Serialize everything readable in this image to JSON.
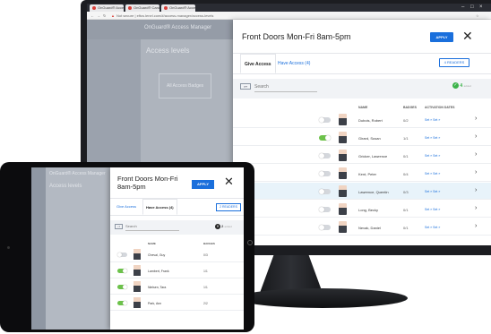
{
  "browser": {
    "tabs": [
      "OnGuard® Access M...",
      "OnGuard® Cardholde...",
      "OnGuard® Access L..."
    ],
    "address": "Not secure | eftcs.lenel.com/#/access-manager/access-levels"
  },
  "background_app": {
    "title": "OnGuard® Access Manager",
    "section": "Access levels",
    "placeholder_card": "All Access Badges"
  },
  "desktop_modal": {
    "title": "Front Doors Mon-Fri 8am-5pm",
    "apply_label": "APPLY",
    "tabs": [
      "Give Access",
      "Have Access (4)"
    ],
    "readers_label": "4 READERS",
    "search_placeholder": "Search",
    "added_count": "4",
    "added_label": "added",
    "columns": [
      "NAME",
      "BADGES",
      "ACTIVATION DATES"
    ],
    "rows": [
      {
        "name": "Dubois, Robert",
        "badges": "0/2",
        "dates": "Set » Set »",
        "toggle": false
      },
      {
        "name": "Girard, Susan",
        "badges": "1/1",
        "dates": "Set » Set »",
        "toggle": true
      },
      {
        "name": "Gricker, Lawrence",
        "badges": "0/1",
        "dates": "Set » Set »",
        "toggle": false
      },
      {
        "name": "Kent, Peter",
        "badges": "0/4",
        "dates": "Set » Set »",
        "toggle": false
      },
      {
        "name": "Lawrence, Quentin",
        "badges": "0/3",
        "dates": "Set » Set »",
        "toggle": false
      },
      {
        "name": "Long, Becky",
        "badges": "0/1",
        "dates": "Set » Set »",
        "toggle": false
      },
      {
        "name": "Nevak, Daniel",
        "badges": "0/1",
        "dates": "Set » Set »",
        "toggle": false
      }
    ]
  },
  "tablet_modal": {
    "title": "Front Doors Mon-Fri 8am-5pm",
    "apply_label": "APPLY",
    "tabs": [
      "Give Access",
      "Have Access (4)"
    ],
    "readers_label": "2 READERS",
    "search_placeholder": "Search",
    "added_count": "2",
    "added_label": "added",
    "columns": [
      "NAME",
      "BADGES"
    ],
    "rows": [
      {
        "name": "Cheval, Guy",
        "badges": "0/3",
        "toggle": false
      },
      {
        "name": "Lambert, Frank",
        "badges": "1/1",
        "toggle": true
      },
      {
        "name": "Nielsen, Tara",
        "badges": "1/1",
        "toggle": true
      },
      {
        "name": "Park, Ann",
        "badges": "2/2",
        "toggle": true
      }
    ]
  },
  "colors": {
    "accent": "#1a6fdc",
    "toggle_on": "#6cc24a",
    "selected_row": "#e8f3fa"
  }
}
